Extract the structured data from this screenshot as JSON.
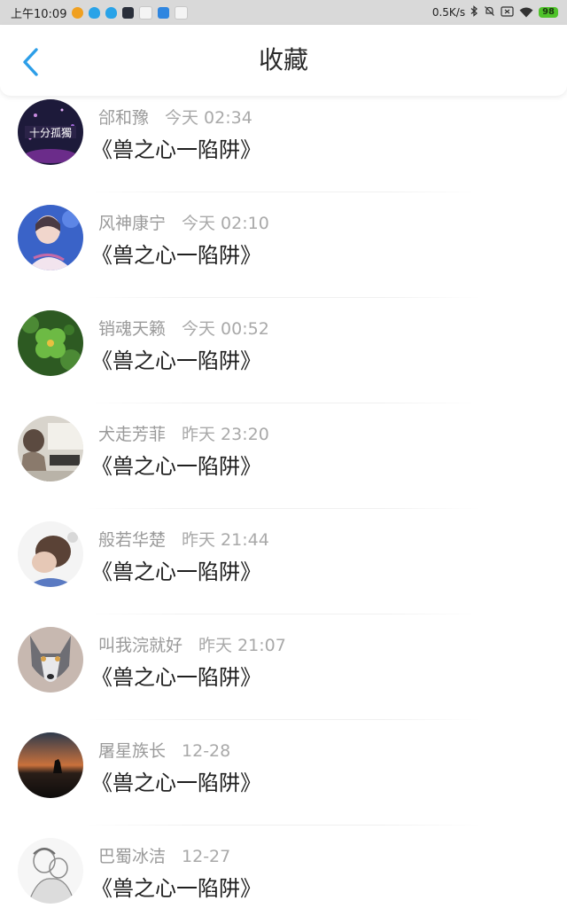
{
  "status_bar": {
    "time": "上午10:09",
    "net_speed": "0.5K/s",
    "battery": "98",
    "app_icons": [
      "weibo-icon",
      "qq-icon",
      "qq-icon",
      "app-dark-icon",
      "app-white-icon",
      "app-blue-icon",
      "app-white-icon"
    ]
  },
  "header": {
    "title": "收藏",
    "back_icon": "chevron-left-icon",
    "accent_color": "#2c9ee8"
  },
  "favorites": [
    {
      "user": "郃和豫",
      "time": "今天 02:34",
      "title": "《兽之心一陷阱》"
    },
    {
      "user": "风神康宁",
      "time": "今天 02:10",
      "title": "《兽之心一陷阱》"
    },
    {
      "user": "销魂天籁",
      "time": "今天 00:52",
      "title": "《兽之心一陷阱》"
    },
    {
      "user": "犬走芳菲",
      "time": "昨天 23:20",
      "title": "《兽之心一陷阱》"
    },
    {
      "user": "般若华楚",
      "time": "昨天 21:44",
      "title": "《兽之心一陷阱》"
    },
    {
      "user": "叫我浣就好",
      "time": "昨天 21:07",
      "title": "《兽之心一陷阱》"
    },
    {
      "user": "屠星族长",
      "time": "12-28",
      "title": "《兽之心一陷阱》"
    },
    {
      "user": "巴蜀冰洁",
      "time": "12-27",
      "title": "《兽之心一陷阱》"
    }
  ]
}
